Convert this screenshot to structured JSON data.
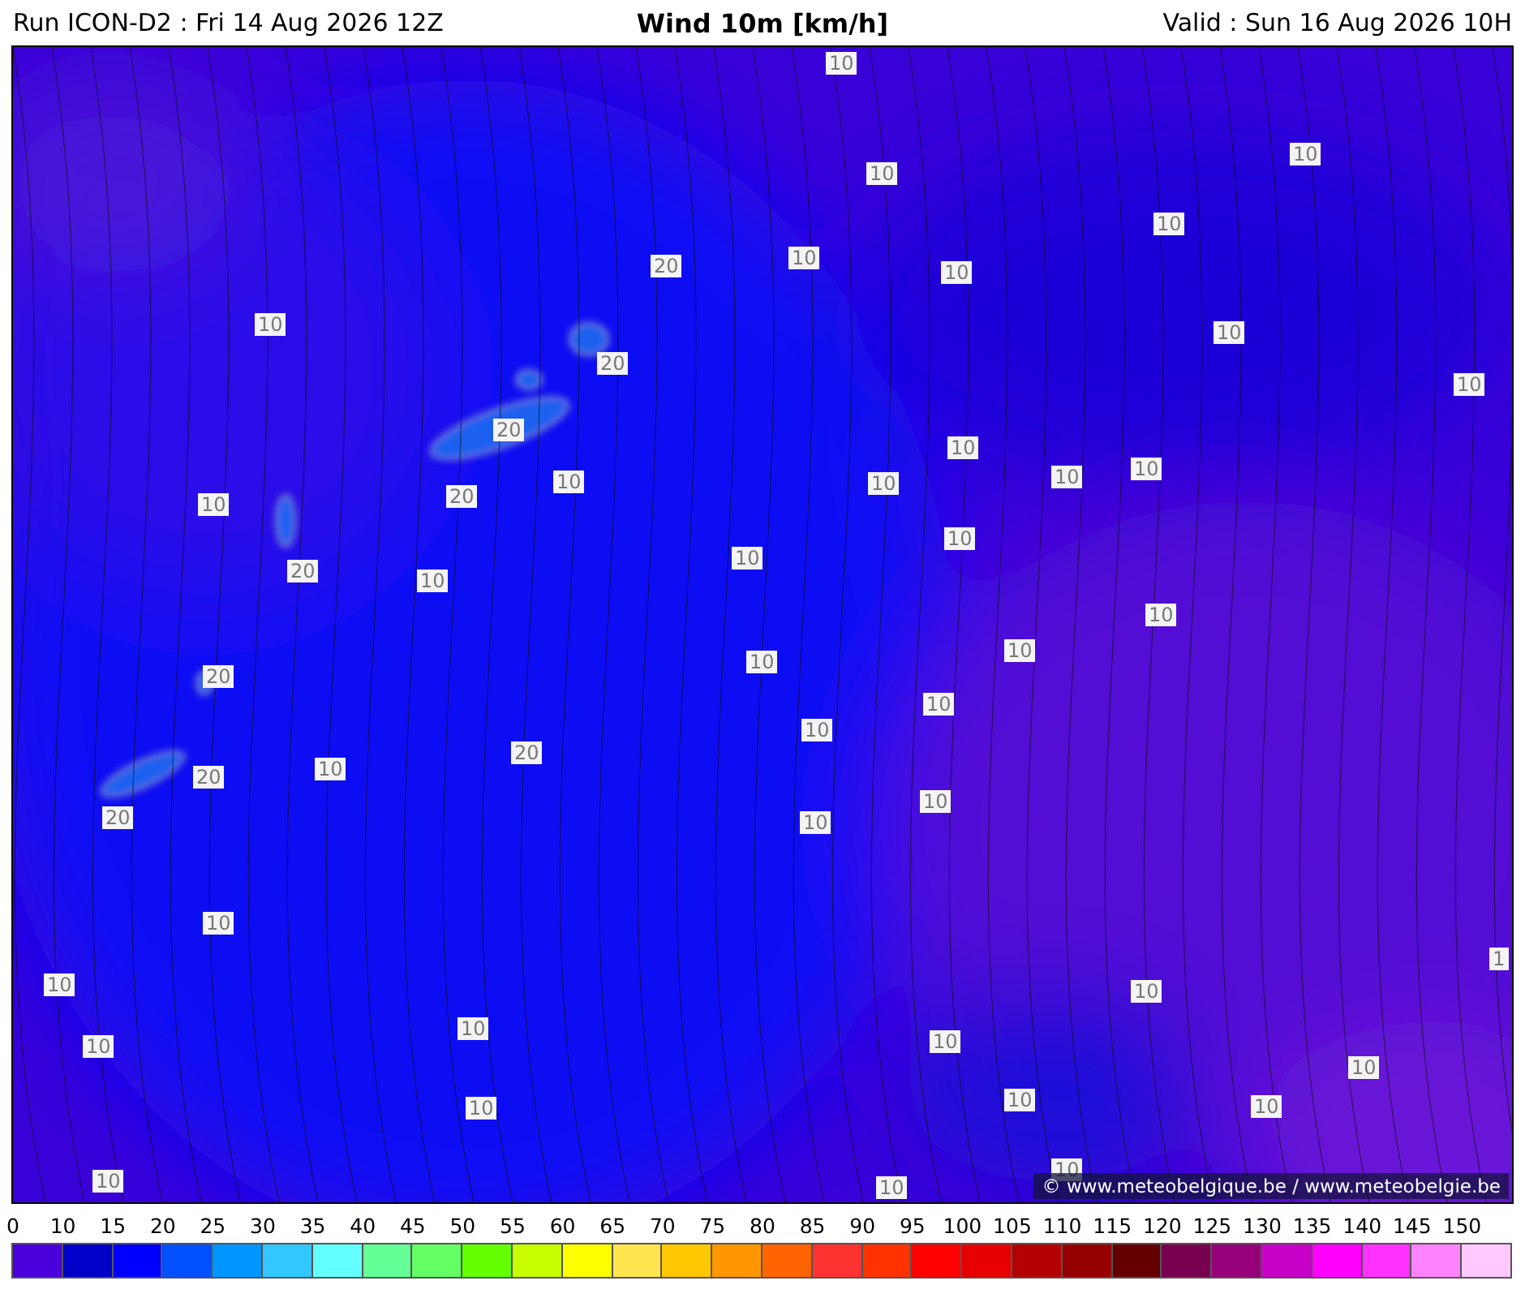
{
  "header": {
    "run": "Run ICON-D2 : Fri 14 Aug 2026 12Z",
    "title": "Wind 10m [km/h]",
    "valid": "Valid : Sun 16 Aug 2026 10H"
  },
  "map": {
    "contour_labels": [
      "10",
      "10",
      "10",
      "10",
      "20",
      "10",
      "10",
      "10",
      "10",
      "20",
      "10",
      "20",
      "10",
      "10",
      "10",
      "10",
      "10",
      "10",
      "20",
      "10",
      "10",
      "20",
      "10",
      "10",
      "20",
      "10",
      "10",
      "10",
      "10",
      "20",
      "10",
      "20",
      "20",
      "10",
      "10",
      "10",
      "1",
      "10",
      "10",
      "10",
      "10",
      "10",
      "10",
      "10",
      "10",
      "10",
      "10",
      "10",
      "10"
    ],
    "credit": "© www.meteobelgique.be / www.meteobelgie.be"
  },
  "legend": [
    {
      "label": "0",
      "color": "#4b00dc"
    },
    {
      "label": "10",
      "color": "#0000c8"
    },
    {
      "label": "15",
      "color": "#0000ff"
    },
    {
      "label": "20",
      "color": "#0050ff"
    },
    {
      "label": "25",
      "color": "#0096ff"
    },
    {
      "label": "30",
      "color": "#32c8ff"
    },
    {
      "label": "35",
      "color": "#64ffff"
    },
    {
      "label": "40",
      "color": "#64ff96"
    },
    {
      "label": "45",
      "color": "#64ff64"
    },
    {
      "label": "50",
      "color": "#64ff00"
    },
    {
      "label": "55",
      "color": "#c8ff00"
    },
    {
      "label": "60",
      "color": "#ffff00"
    },
    {
      "label": "65",
      "color": "#ffe650"
    },
    {
      "label": "70",
      "color": "#ffc800"
    },
    {
      "label": "75",
      "color": "#ff9600"
    },
    {
      "label": "80",
      "color": "#ff6400"
    },
    {
      "label": "85",
      "color": "#ff3232"
    },
    {
      "label": "90",
      "color": "#ff3200"
    },
    {
      "label": "95",
      "color": "#ff0000"
    },
    {
      "label": "100",
      "color": "#e60000"
    },
    {
      "label": "105",
      "color": "#b40000"
    },
    {
      "label": "110",
      "color": "#960000"
    },
    {
      "label": "115",
      "color": "#640000"
    },
    {
      "label": "120",
      "color": "#780050"
    },
    {
      "label": "125",
      "color": "#960078"
    },
    {
      "label": "130",
      "color": "#c800c8"
    },
    {
      "label": "135",
      "color": "#ff00ff"
    },
    {
      "label": "140",
      "color": "#ff32ff"
    },
    {
      "label": "145",
      "color": "#ff82ff"
    },
    {
      "label": "150",
      "color": "#ffc8ff"
    }
  ]
}
